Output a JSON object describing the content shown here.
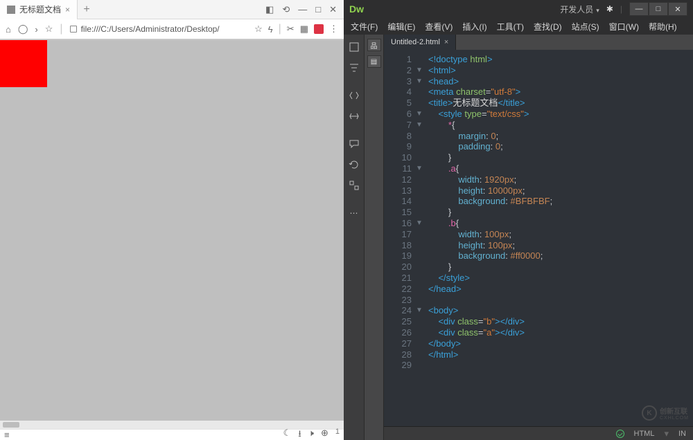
{
  "browser": {
    "tab_title": "无标题文档",
    "url": "file:///C:/Users/Administrator/Desktop/",
    "new_tab": "+",
    "close_x": "×",
    "status_zoom": "1",
    "status_menu": "≡"
  },
  "dw": {
    "logo": "Dw",
    "role": "开发人员",
    "menu": [
      "文件(F)",
      "编辑(E)",
      "查看(V)",
      "插入(I)",
      "工具(T)",
      "查找(D)",
      "站点(S)",
      "窗口(W)",
      "帮助(H)"
    ],
    "tab": "Untitled-2.html",
    "tab_x": "×",
    "status_lang": "HTML",
    "status_ins": "IN"
  },
  "code": {
    "lines": [
      {
        "n": 1,
        "f": "",
        "html": "<span class='tg-tag'>&lt;!doctype</span> <span class='tg-attr'>html</span><span class='tg-tag'>&gt;</span>"
      },
      {
        "n": 2,
        "f": "▼",
        "html": "<span class='tg-tag'>&lt;html&gt;</span>"
      },
      {
        "n": 3,
        "f": "▼",
        "html": "<span class='tg-tag'>&lt;head&gt;</span>"
      },
      {
        "n": 4,
        "f": "",
        "html": "<span class='tg-tag'>&lt;meta</span> <span class='tg-attr'>charset</span><span class='tg-punc'>=</span><span class='tg-str'>\"utf-8\"</span><span class='tg-tag'>&gt;</span>"
      },
      {
        "n": 5,
        "f": "",
        "html": "<span class='tg-tag'>&lt;title&gt;</span><span class='tg-text'>无标题文档</span><span class='tg-tag'>&lt;/title&gt;</span>"
      },
      {
        "n": 6,
        "f": "▼",
        "html": "    <span class='tg-tag'>&lt;style</span> <span class='tg-attr'>type</span><span class='tg-punc'>=</span><span class='tg-str'>\"text/css\"</span><span class='tg-tag'>&gt;</span>"
      },
      {
        "n": 7,
        "f": "▼",
        "html": "        <span class='tg-sel'>*</span><span class='tg-punc'>{</span>"
      },
      {
        "n": 8,
        "f": "",
        "html": "            <span class='tg-prop'>margin</span><span class='tg-punc'>:</span> <span class='tg-num'>0</span><span class='tg-punc'>;</span>"
      },
      {
        "n": 9,
        "f": "",
        "html": "            <span class='tg-prop'>padding</span><span class='tg-punc'>:</span> <span class='tg-num'>0</span><span class='tg-punc'>;</span>"
      },
      {
        "n": 10,
        "f": "",
        "html": "        <span class='tg-punc'>}</span>"
      },
      {
        "n": 11,
        "f": "▼",
        "html": "        <span class='tg-sel'>.a</span><span class='tg-punc'>{</span>"
      },
      {
        "n": 12,
        "f": "",
        "html": "            <span class='tg-prop'>width</span><span class='tg-punc'>:</span> <span class='tg-num'>1920px</span><span class='tg-punc'>;</span>"
      },
      {
        "n": 13,
        "f": "",
        "html": "            <span class='tg-prop'>height</span><span class='tg-punc'>:</span> <span class='tg-num'>10000px</span><span class='tg-punc'>;</span>"
      },
      {
        "n": 14,
        "f": "",
        "html": "            <span class='tg-prop'>background</span><span class='tg-punc'>:</span> <span class='tg-val'>#BFBFBF</span><span class='tg-punc'>;</span>"
      },
      {
        "n": 15,
        "f": "",
        "html": "        <span class='tg-punc'>}</span>"
      },
      {
        "n": 16,
        "f": "▼",
        "html": "        <span class='tg-sel'>.b</span><span class='tg-punc'>{</span>"
      },
      {
        "n": 17,
        "f": "",
        "html": "            <span class='tg-prop'>width</span><span class='tg-punc'>:</span> <span class='tg-num'>100px</span><span class='tg-punc'>;</span>"
      },
      {
        "n": 18,
        "f": "",
        "html": "            <span class='tg-prop'>height</span><span class='tg-punc'>:</span> <span class='tg-num'>100px</span><span class='tg-punc'>;</span>"
      },
      {
        "n": 19,
        "f": "",
        "html": "            <span class='tg-prop'>background</span><span class='tg-punc'>:</span> <span class='tg-val'>#ff0000</span><span class='tg-punc'>;</span>"
      },
      {
        "n": 20,
        "f": "",
        "html": "        <span class='tg-punc'>}</span>"
      },
      {
        "n": 21,
        "f": "",
        "html": "    <span class='tg-tag'>&lt;/style&gt;</span>"
      },
      {
        "n": 22,
        "f": "",
        "html": "<span class='tg-tag'>&lt;/head&gt;</span>"
      },
      {
        "n": 23,
        "f": "",
        "html": ""
      },
      {
        "n": 24,
        "f": "▼",
        "html": "<span class='tg-tag'>&lt;body&gt;</span>"
      },
      {
        "n": 25,
        "f": "",
        "html": "    <span class='tg-tag'>&lt;div</span> <span class='tg-attr'>class</span><span class='tg-punc'>=</span><span class='tg-str'>\"b\"</span><span class='tg-tag'>&gt;&lt;/div&gt;</span>"
      },
      {
        "n": 26,
        "f": "",
        "html": "    <span class='tg-tag'>&lt;div</span> <span class='tg-attr'>class</span><span class='tg-punc'>=</span><span class='tg-str'>\"a\"</span><span class='tg-tag'>&gt;&lt;/div&gt;</span>"
      },
      {
        "n": 27,
        "f": "",
        "html": "<span class='tg-tag'>&lt;/body&gt;</span>"
      },
      {
        "n": 28,
        "f": "",
        "html": "<span class='tg-tag'>&lt;/html&gt;</span>"
      },
      {
        "n": 29,
        "f": "",
        "html": ""
      }
    ]
  },
  "watermark": {
    "brand": "创新互联",
    "sub": "CXHLCOM"
  }
}
